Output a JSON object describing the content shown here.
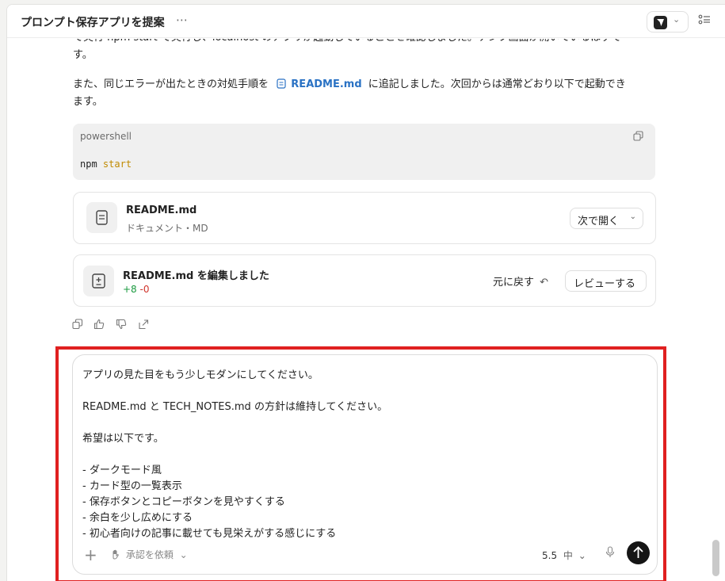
{
  "header": {
    "title": "プロンプト保存アプリを提案",
    "more": "⋯",
    "model_chevron": "⌄"
  },
  "messages": {
    "partial_line_1": "で実行 npm start で実行し、localhost のアプリが起動していることを確認しました。テンプ画面が開いているはずで",
    "partial_line_2": "す。",
    "line_3_before": "また、同じエラーが出たときの対処手順を",
    "line_3_link": "README.md",
    "line_3_after": "に追記しました。次回からは通常どおり以下で起動でき",
    "line_4": "ます。"
  },
  "code_block": {
    "language": "powershell",
    "command": "npm",
    "argument": "start"
  },
  "file_card": {
    "name": "README.md",
    "subtitle": "ドキュメント・MD",
    "open_label": "次で開く",
    "open_chevron": "⌄"
  },
  "edit_card": {
    "title": "README.md を編集しました",
    "additions": "+8",
    "deletions": "-0",
    "undo_label": "元に戻す",
    "undo_icon": "↶",
    "review_label": "レビューする"
  },
  "composer": {
    "lines": [
      "アプリの見た目をもう少しモダンにしてください。",
      "",
      "README.md と TECH_NOTES.md の方針は維持してください。",
      "",
      "希望は以下です。",
      "",
      "- ダークモード風",
      "- カード型の一覧表示",
      "- 保存ボタンとコピーボタンを見やすくする",
      "- 余白を少し広めにする",
      "- 初心者向けの記事に載せても見栄えがする感じにする"
    ],
    "plus": "+",
    "approval_label": "承認を依頼",
    "approval_chevron": "⌄",
    "model_version": "5.5",
    "effort": "中",
    "effort_chevron": "⌄"
  },
  "colors": {
    "accent_red_frame": "#e02020",
    "link_blue": "#2a72c4",
    "add_green": "#1a9a3f",
    "del_red": "#d0342c",
    "code_arg": "#c08a00"
  }
}
